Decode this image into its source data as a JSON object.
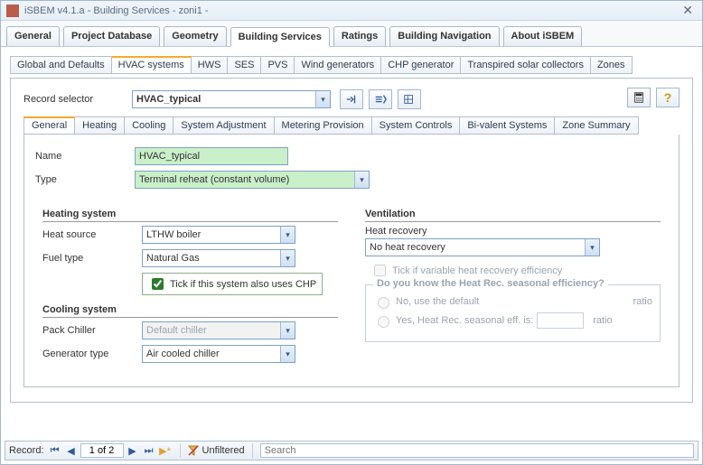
{
  "window": {
    "title": "iSBEM v4.1.a - Building Services - zoni1 -"
  },
  "maintabs": [
    "General",
    "Project Database",
    "Geometry",
    "Building Services",
    "Ratings",
    "Building Navigation",
    "About iSBEM"
  ],
  "maintab_active": 3,
  "subtabs": [
    "Global and Defaults",
    "HVAC systems",
    "HWS",
    "SES",
    "PVS",
    "Wind generators",
    "CHP generator",
    "Transpired solar collectors",
    "Zones"
  ],
  "subtab_active": 1,
  "record_selector": {
    "label": "Record selector",
    "value": "HVAC_typical"
  },
  "innertabs": [
    "General",
    "Heating",
    "Cooling",
    "System Adjustment",
    "Metering Provision",
    "System Controls",
    "Bi-valent Systems",
    "Zone Summary"
  ],
  "innertab_active": 0,
  "fields": {
    "name_label": "Name",
    "name_value": "HVAC_typical",
    "type_label": "Type",
    "type_value": "Terminal reheat (constant volume)"
  },
  "heating": {
    "title": "Heating system",
    "heat_source_label": "Heat source",
    "heat_source_value": "LTHW boiler",
    "fuel_label": "Fuel type",
    "fuel_value": "Natural Gas",
    "chp_label": "Tick if this system also uses CHP",
    "chp_checked": true
  },
  "cooling": {
    "title": "Cooling system",
    "pack_label": "Pack Chiller",
    "pack_value": "Default chiller",
    "gen_label": "Generator type",
    "gen_value": "Air cooled chiller"
  },
  "ventilation": {
    "title": "Ventilation",
    "hr_label": "Heat recovery",
    "hr_value": "No heat recovery",
    "var_label": "Tick if variable heat recovery efficiency",
    "group_label": "Do you know the Heat Rec. seasonal efficiency?",
    "opt_no": "No, use the default",
    "opt_yes": "Yes, Heat Rec. seasonal eff. is:",
    "ratio": "ratio"
  },
  "nav": {
    "record_label": "Record:",
    "pos": "1 of 2",
    "filter": "Unfiltered",
    "search_placeholder": "Search"
  }
}
